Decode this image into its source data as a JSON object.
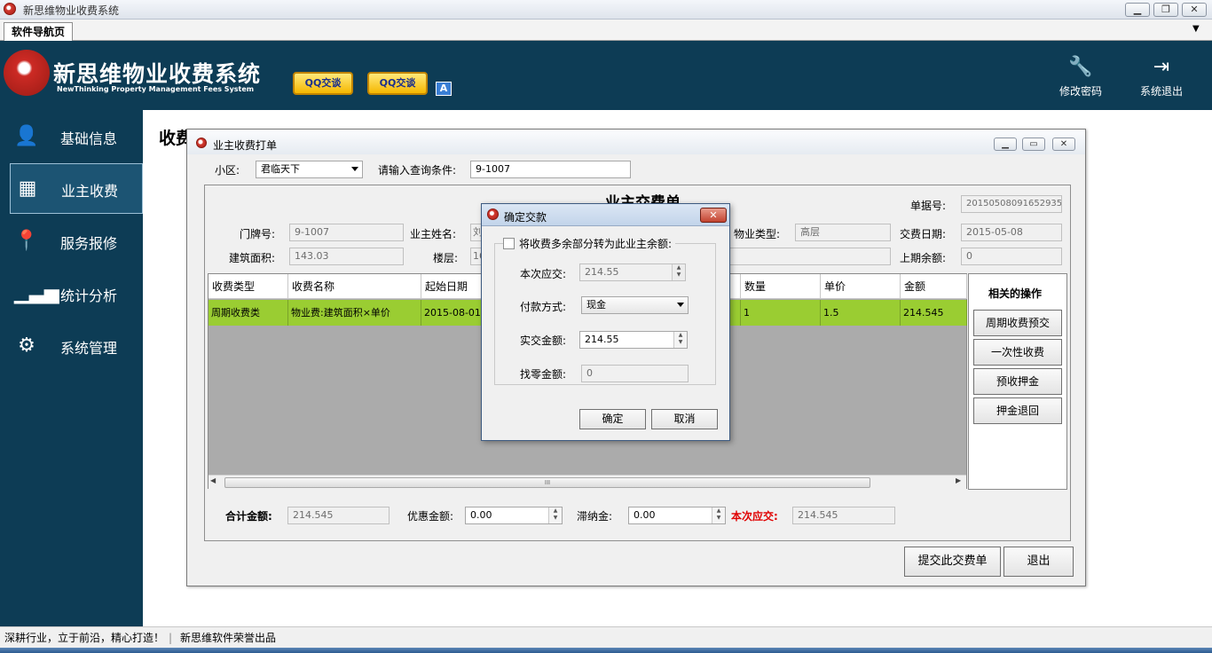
{
  "window": {
    "title": "新思维物业收费系统",
    "minimize": "▁",
    "restore": "❐",
    "close": "✕"
  },
  "tabs": {
    "active": "软件导航页",
    "menu_arrow": "▼"
  },
  "header": {
    "app_name": "新思维物业收费系统",
    "app_subtitle": "NewThinking Property Management Fees System",
    "qq1": "QQ交谈",
    "qq2": "QQ交谈",
    "a_badge": "A",
    "change_password": "修改密码",
    "logout": "系统退出"
  },
  "sidebar": {
    "items": [
      {
        "label": "基础信息",
        "icon": "user-icon"
      },
      {
        "label": "业主收费",
        "icon": "calendar-icon"
      },
      {
        "label": "服务报修",
        "icon": "location-pin-icon"
      },
      {
        "label": "统计分析",
        "icon": "bar-chart-icon"
      },
      {
        "label": "系统管理",
        "icon": "gear-icon"
      }
    ]
  },
  "page_title": "收费",
  "form": {
    "title": "业主收费打单",
    "community_label": "小区:",
    "community_value": "君临天下",
    "query_label": "请输入查询条件:",
    "query_value": "9-1007",
    "receipt_title": "业主交费单",
    "receipt_no_label": "单据号:",
    "receipt_no": "20150508091652935",
    "door_label": "门牌号:",
    "door_value": "9-1007",
    "owner_label": "业主姓名:",
    "owner_value": "刘",
    "property_type_label": "物业类型:",
    "property_type_value": "高层",
    "date_label": "交费日期:",
    "date_value": "2015-05-08",
    "area_label": "建筑面积:",
    "area_value": "143.03",
    "floor_label": "楼层:",
    "floor_value": "16",
    "prev_balance_label": "上期余额:",
    "prev_balance_value": "0",
    "table": {
      "headers": [
        "收费类型",
        "收费名称",
        "起始日期",
        "数量",
        "单价",
        "金额"
      ],
      "rows": [
        [
          "周期收费类",
          "物业费:建筑面积×单价",
          "2015-08-01",
          "1",
          "1.5",
          "214.545"
        ]
      ]
    },
    "ops_title": "相关的操作",
    "ops": [
      "周期收费预交",
      "一次性收费",
      "预收押金",
      "押金退回"
    ],
    "total_label": "合计金额:",
    "total_value": "214.545",
    "discount_label": "优惠金额:",
    "discount_value": "0.00",
    "late_fee_label": "滞纳金:",
    "late_fee_value": "0.00",
    "due_label": "本次应交:",
    "due_value": "214.545",
    "submit": "提交此交费单",
    "exit": "退出",
    "scroll_grip": "III"
  },
  "dialog": {
    "title": "确定交款",
    "checkbox_label": "将收费多余部分转为此业主余额:",
    "due_label": "本次应交:",
    "due_value": "214.55",
    "pay_method_label": "付款方式:",
    "pay_method_value": "现金",
    "paid_label": "实交金额:",
    "paid_value": "214.55",
    "change_label": "找零金额:",
    "change_value": "0",
    "ok": "确定",
    "cancel": "取消"
  },
  "status": {
    "text1": "深耕行业，立于前沿，精心打造！",
    "text2": "新思维软件荣誉出品"
  },
  "colors": {
    "banner": "#0d3c55",
    "row_highlight": "#9acd32",
    "due_label": "#e00000"
  }
}
